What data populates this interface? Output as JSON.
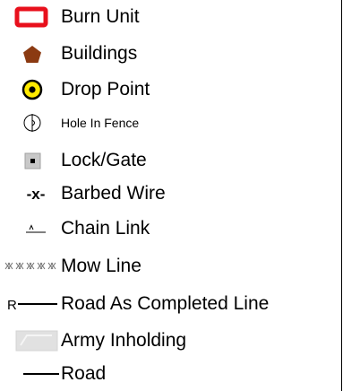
{
  "legend": {
    "items": [
      {
        "label": "Burn Unit",
        "icon": "burn-unit-icon",
        "color": "#e8101c"
      },
      {
        "label": "Buildings",
        "icon": "building-pentagon-icon",
        "color": "#8b3a12"
      },
      {
        "label": "Drop Point",
        "icon": "drop-point-icon",
        "color": "#ffea00"
      },
      {
        "label": "Hole In Fence",
        "icon": "hole-in-fence-icon",
        "color": "#000000"
      },
      {
        "label": "Lock/Gate",
        "icon": "lock-gate-icon",
        "color": "#c8c8c8"
      },
      {
        "label": "Barbed Wire",
        "icon": "barbed-wire-icon",
        "color": "#000000"
      },
      {
        "label": "Chain Link",
        "icon": "chain-link-icon",
        "color": "#000000"
      },
      {
        "label": "Mow Line",
        "icon": "mow-line-icon",
        "color": "#6e6e6e"
      },
      {
        "label": "Road As Completed Line",
        "icon": "road-completed-line-icon",
        "color": "#000000"
      },
      {
        "label": "Army Inholding",
        "icon": "army-inholding-icon",
        "color": "#e1e1e1"
      },
      {
        "label": "Road",
        "icon": "road-line-icon",
        "color": "#000000"
      }
    ],
    "symbol_glyphs": {
      "barbed": "-x-",
      "chain": "^",
      "road_completed": "R"
    }
  }
}
